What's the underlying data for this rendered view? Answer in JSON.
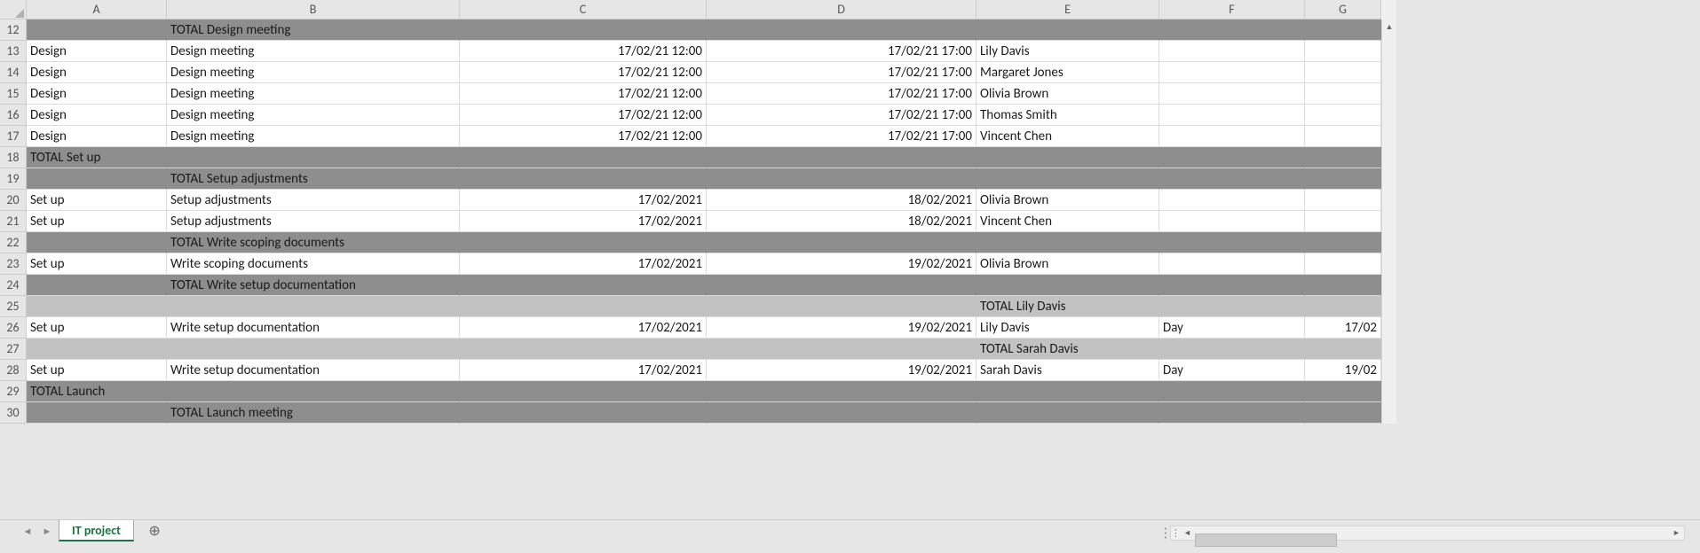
{
  "columns": [
    "A",
    "B",
    "C",
    "D",
    "E",
    "F",
    "G"
  ],
  "row_headers": [
    "12",
    "13",
    "14",
    "15",
    "16",
    "17",
    "18",
    "19",
    "20",
    "21",
    "22",
    "23",
    "24",
    "25",
    "26",
    "27",
    "28",
    "29",
    "30"
  ],
  "sheet_tab": "IT project",
  "rows": [
    {
      "style": "dark",
      "A": "",
      "B": "TOTAL Design meeting",
      "C": "",
      "D": "",
      "E": "",
      "F": "",
      "G": ""
    },
    {
      "style": "",
      "A": "Design",
      "B": "Design meeting",
      "C": "17/02/21 12:00",
      "D": "17/02/21 17:00",
      "E": "Lily Davis",
      "F": "",
      "G": ""
    },
    {
      "style": "",
      "A": "Design",
      "B": "Design meeting",
      "C": "17/02/21 12:00",
      "D": "17/02/21 17:00",
      "E": "Margaret Jones",
      "F": "",
      "G": ""
    },
    {
      "style": "",
      "A": "Design",
      "B": "Design meeting",
      "C": "17/02/21 12:00",
      "D": "17/02/21 17:00",
      "E": "Olivia Brown",
      "F": "",
      "G": ""
    },
    {
      "style": "",
      "A": "Design",
      "B": "Design meeting",
      "C": "17/02/21 12:00",
      "D": "17/02/21 17:00",
      "E": "Thomas Smith",
      "F": "",
      "G": ""
    },
    {
      "style": "",
      "A": "Design",
      "B": "Design meeting",
      "C": "17/02/21 12:00",
      "D": "17/02/21 17:00",
      "E": "Vincent Chen",
      "F": "",
      "G": ""
    },
    {
      "style": "dark",
      "A": "TOTAL Set up",
      "B": "",
      "C": "",
      "D": "",
      "E": "",
      "F": "",
      "G": ""
    },
    {
      "style": "dark",
      "A": "",
      "B": "TOTAL Setup adjustments",
      "C": "",
      "D": "",
      "E": "",
      "F": "",
      "G": ""
    },
    {
      "style": "",
      "A": "Set up",
      "B": "Setup adjustments",
      "C": "17/02/2021",
      "D": "18/02/2021",
      "E": "Olivia Brown",
      "F": "",
      "G": ""
    },
    {
      "style": "",
      "A": "Set up",
      "B": "Setup adjustments",
      "C": "17/02/2021",
      "D": "18/02/2021",
      "E": "Vincent Chen",
      "F": "",
      "G": ""
    },
    {
      "style": "dark",
      "A": "",
      "B": "TOTAL Write scoping documents",
      "C": "",
      "D": "",
      "E": "",
      "F": "",
      "G": ""
    },
    {
      "style": "",
      "A": "Set up",
      "B": "Write scoping documents",
      "C": "17/02/2021",
      "D": "19/02/2021",
      "E": "Olivia Brown",
      "F": "",
      "G": ""
    },
    {
      "style": "dark",
      "A": "",
      "B": "TOTAL Write setup documentation",
      "C": "",
      "D": "",
      "E": "",
      "F": "",
      "G": ""
    },
    {
      "style": "light",
      "A": "",
      "B": "",
      "C": "",
      "D": "",
      "E": "TOTAL Lily Davis",
      "F": "",
      "G": ""
    },
    {
      "style": "",
      "A": "Set up",
      "B": "Write setup documentation",
      "C": "17/02/2021",
      "D": "19/02/2021",
      "E": "Lily Davis",
      "F": "Day",
      "G": "17/02"
    },
    {
      "style": "light",
      "A": "",
      "B": "",
      "C": "",
      "D": "",
      "E": "TOTAL Sarah Davis",
      "F": "",
      "G": ""
    },
    {
      "style": "",
      "A": "Set up",
      "B": "Write setup documentation",
      "C": "17/02/2021",
      "D": "19/02/2021",
      "E": "Sarah Davis",
      "F": "Day",
      "G": "19/02"
    },
    {
      "style": "dark",
      "A": "TOTAL Launch",
      "B": "",
      "C": "",
      "D": "",
      "E": "",
      "F": "",
      "G": ""
    },
    {
      "style": "dark",
      "A": "",
      "B": "TOTAL Launch meeting",
      "C": "",
      "D": "",
      "E": "",
      "F": "",
      "G": ""
    }
  ]
}
